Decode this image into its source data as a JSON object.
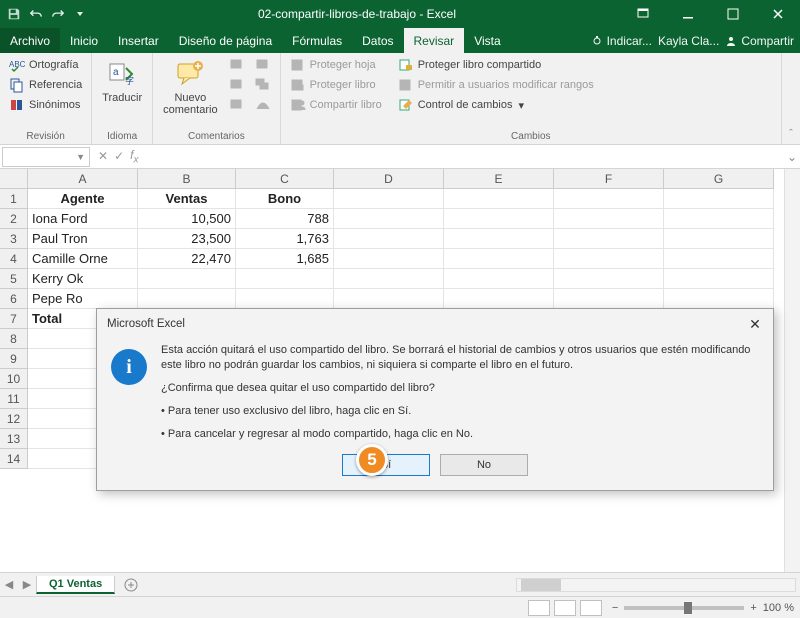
{
  "title": "02-compartir-libros-de-trabajo - Excel",
  "qat": {
    "save": "",
    "undo": "",
    "redo": ""
  },
  "tellme": "Indicar...",
  "user": "Kayla Cla...",
  "share": "Compartir",
  "tabs": {
    "file": "Archivo",
    "home": "Inicio",
    "insert": "Insertar",
    "pagelayout": "Diseño de página",
    "formulas": "Fórmulas",
    "data": "Datos",
    "review": "Revisar",
    "view": "Vista"
  },
  "ribbon": {
    "proofing": {
      "spelling": "Ortografía",
      "research": "Referencia",
      "thesaurus": "Sinónimos",
      "label": "Revisión"
    },
    "language": {
      "translate": "Traducir",
      "label": "Idioma"
    },
    "comments": {
      "new": "Nuevo\ncomentario",
      "label": "Comentarios"
    },
    "changes": {
      "protectSheet": "Proteger hoja",
      "protectWorkbook": "Proteger libro",
      "shareWorkbook": "Compartir libro",
      "protectShared": "Proteger libro compartido",
      "allowRanges": "Permitir a usuarios modificar rangos",
      "trackChanges": "Control de cambios",
      "label": "Cambios"
    }
  },
  "namebox": "",
  "formula": "",
  "columns": [
    "A",
    "B",
    "C",
    "D",
    "E",
    "F",
    "G"
  ],
  "rows": [
    "1",
    "2",
    "3",
    "4",
    "5",
    "6",
    "7",
    "8",
    "9",
    "10",
    "11",
    "12",
    "13",
    "14"
  ],
  "data": {
    "header": [
      "Agente",
      "Ventas",
      "Bono"
    ],
    "r2": [
      "Iona Ford",
      "10,500",
      "788"
    ],
    "r3": [
      "Paul Tron",
      "23,500",
      "1,763"
    ],
    "r4": [
      "Camille  Orne",
      "22,470",
      "1,685"
    ],
    "r5": [
      "Kerry Ok",
      "",
      ""
    ],
    "r6": [
      "Pepe Ro",
      "",
      ""
    ],
    "r7": [
      "Total",
      "",
      ""
    ]
  },
  "sheet": "Q1 Ventas",
  "status": {
    "ready": "",
    "zoom": "100 %"
  },
  "dialog": {
    "title": "Microsoft Excel",
    "p1": "Esta acción quitará el uso compartido del libro. Se borrará el historial de cambios y otros usuarios que estén modificando este libro no podrán guardar los cambios, ni siquiera si comparte el libro en el futuro.",
    "p2": "¿Confirma que desea quitar el uso compartido del libro?",
    "b1": "• Para tener uso exclusivo del libro, haga clic en Sí.",
    "b2": "• Para cancelar y regresar al modo compartido, haga clic en No.",
    "yes": "Sí",
    "no": "No"
  },
  "callout": "5"
}
